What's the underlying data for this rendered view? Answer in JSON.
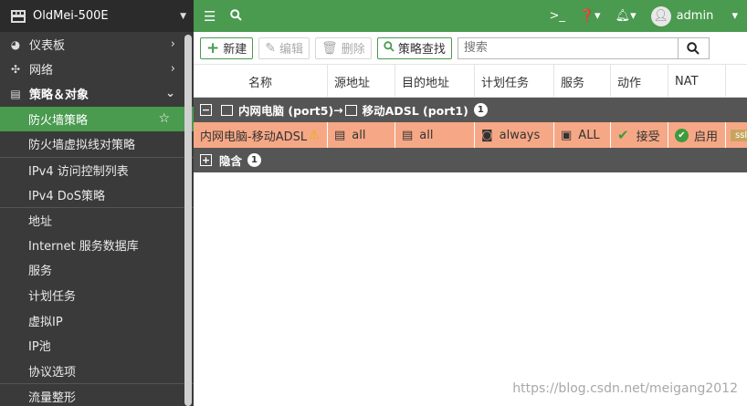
{
  "device": {
    "name": "OldMei-500E"
  },
  "sidebar": {
    "top_items": [
      {
        "icon": "dashboard-icon",
        "label": "仪表板"
      },
      {
        "icon": "network-icon",
        "label": "网络"
      }
    ],
    "section": {
      "icon": "policy-icon",
      "label": "策略＆对象"
    },
    "sub_items": [
      {
        "label": "防火墙策略",
        "active": true
      },
      {
        "label": "防火墙虚拟线对策略"
      },
      {
        "label": "IPv4 访问控制列表"
      },
      {
        "label": "IPv4 DoS策略"
      },
      {
        "label": "地址"
      },
      {
        "label": "Internet 服务数据库"
      },
      {
        "label": "服务"
      },
      {
        "label": "计划任务"
      },
      {
        "label": "虚拟IP"
      },
      {
        "label": "IP池"
      },
      {
        "label": "协议选项"
      },
      {
        "label": "流量整形"
      }
    ]
  },
  "topbar": {
    "user": "admin"
  },
  "toolbar": {
    "new_label": "新建",
    "edit_label": "编辑",
    "delete_label": "删除",
    "find_label": "策略查找",
    "search_placeholder": "搜索"
  },
  "table": {
    "columns": [
      "名称",
      "源地址",
      "目的地址",
      "计划任务",
      "服务",
      "动作",
      "NAT"
    ],
    "group": {
      "src": "内网电脑 (port5)",
      "arrow": "→",
      "dst": "移动ADSL (port1)",
      "count": "1"
    },
    "policy": {
      "name": "内网电脑-移动ADSL",
      "src": "all",
      "dst": "all",
      "schedule": "always",
      "service": "ALL",
      "action": "接受",
      "nat": "启用",
      "extra": "ssl"
    },
    "hidden_group": {
      "label": "隐含",
      "count": "1"
    }
  },
  "watermark": "https://blog.csdn.net/meigang2012"
}
